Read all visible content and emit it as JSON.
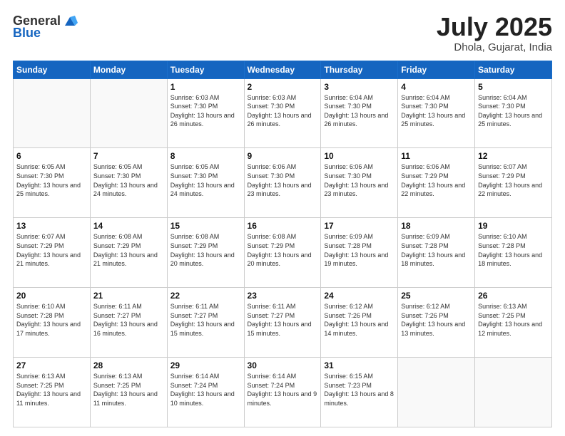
{
  "header": {
    "logo_general": "General",
    "logo_blue": "Blue",
    "month_title": "July 2025",
    "location": "Dhola, Gujarat, India"
  },
  "days_of_week": [
    "Sunday",
    "Monday",
    "Tuesday",
    "Wednesday",
    "Thursday",
    "Friday",
    "Saturday"
  ],
  "weeks": [
    [
      {
        "day": "",
        "info": ""
      },
      {
        "day": "",
        "info": ""
      },
      {
        "day": "1",
        "info": "Sunrise: 6:03 AM\nSunset: 7:30 PM\nDaylight: 13 hours and 26 minutes."
      },
      {
        "day": "2",
        "info": "Sunrise: 6:03 AM\nSunset: 7:30 PM\nDaylight: 13 hours and 26 minutes."
      },
      {
        "day": "3",
        "info": "Sunrise: 6:04 AM\nSunset: 7:30 PM\nDaylight: 13 hours and 26 minutes."
      },
      {
        "day": "4",
        "info": "Sunrise: 6:04 AM\nSunset: 7:30 PM\nDaylight: 13 hours and 25 minutes."
      },
      {
        "day": "5",
        "info": "Sunrise: 6:04 AM\nSunset: 7:30 PM\nDaylight: 13 hours and 25 minutes."
      }
    ],
    [
      {
        "day": "6",
        "info": "Sunrise: 6:05 AM\nSunset: 7:30 PM\nDaylight: 13 hours and 25 minutes."
      },
      {
        "day": "7",
        "info": "Sunrise: 6:05 AM\nSunset: 7:30 PM\nDaylight: 13 hours and 24 minutes."
      },
      {
        "day": "8",
        "info": "Sunrise: 6:05 AM\nSunset: 7:30 PM\nDaylight: 13 hours and 24 minutes."
      },
      {
        "day": "9",
        "info": "Sunrise: 6:06 AM\nSunset: 7:30 PM\nDaylight: 13 hours and 23 minutes."
      },
      {
        "day": "10",
        "info": "Sunrise: 6:06 AM\nSunset: 7:30 PM\nDaylight: 13 hours and 23 minutes."
      },
      {
        "day": "11",
        "info": "Sunrise: 6:06 AM\nSunset: 7:29 PM\nDaylight: 13 hours and 22 minutes."
      },
      {
        "day": "12",
        "info": "Sunrise: 6:07 AM\nSunset: 7:29 PM\nDaylight: 13 hours and 22 minutes."
      }
    ],
    [
      {
        "day": "13",
        "info": "Sunrise: 6:07 AM\nSunset: 7:29 PM\nDaylight: 13 hours and 21 minutes."
      },
      {
        "day": "14",
        "info": "Sunrise: 6:08 AM\nSunset: 7:29 PM\nDaylight: 13 hours and 21 minutes."
      },
      {
        "day": "15",
        "info": "Sunrise: 6:08 AM\nSunset: 7:29 PM\nDaylight: 13 hours and 20 minutes."
      },
      {
        "day": "16",
        "info": "Sunrise: 6:08 AM\nSunset: 7:29 PM\nDaylight: 13 hours and 20 minutes."
      },
      {
        "day": "17",
        "info": "Sunrise: 6:09 AM\nSunset: 7:28 PM\nDaylight: 13 hours and 19 minutes."
      },
      {
        "day": "18",
        "info": "Sunrise: 6:09 AM\nSunset: 7:28 PM\nDaylight: 13 hours and 18 minutes."
      },
      {
        "day": "19",
        "info": "Sunrise: 6:10 AM\nSunset: 7:28 PM\nDaylight: 13 hours and 18 minutes."
      }
    ],
    [
      {
        "day": "20",
        "info": "Sunrise: 6:10 AM\nSunset: 7:28 PM\nDaylight: 13 hours and 17 minutes."
      },
      {
        "day": "21",
        "info": "Sunrise: 6:11 AM\nSunset: 7:27 PM\nDaylight: 13 hours and 16 minutes."
      },
      {
        "day": "22",
        "info": "Sunrise: 6:11 AM\nSunset: 7:27 PM\nDaylight: 13 hours and 15 minutes."
      },
      {
        "day": "23",
        "info": "Sunrise: 6:11 AM\nSunset: 7:27 PM\nDaylight: 13 hours and 15 minutes."
      },
      {
        "day": "24",
        "info": "Sunrise: 6:12 AM\nSunset: 7:26 PM\nDaylight: 13 hours and 14 minutes."
      },
      {
        "day": "25",
        "info": "Sunrise: 6:12 AM\nSunset: 7:26 PM\nDaylight: 13 hours and 13 minutes."
      },
      {
        "day": "26",
        "info": "Sunrise: 6:13 AM\nSunset: 7:25 PM\nDaylight: 13 hours and 12 minutes."
      }
    ],
    [
      {
        "day": "27",
        "info": "Sunrise: 6:13 AM\nSunset: 7:25 PM\nDaylight: 13 hours and 11 minutes."
      },
      {
        "day": "28",
        "info": "Sunrise: 6:13 AM\nSunset: 7:25 PM\nDaylight: 13 hours and 11 minutes."
      },
      {
        "day": "29",
        "info": "Sunrise: 6:14 AM\nSunset: 7:24 PM\nDaylight: 13 hours and 10 minutes."
      },
      {
        "day": "30",
        "info": "Sunrise: 6:14 AM\nSunset: 7:24 PM\nDaylight: 13 hours and 9 minutes."
      },
      {
        "day": "31",
        "info": "Sunrise: 6:15 AM\nSunset: 7:23 PM\nDaylight: 13 hours and 8 minutes."
      },
      {
        "day": "",
        "info": ""
      },
      {
        "day": "",
        "info": ""
      }
    ]
  ]
}
